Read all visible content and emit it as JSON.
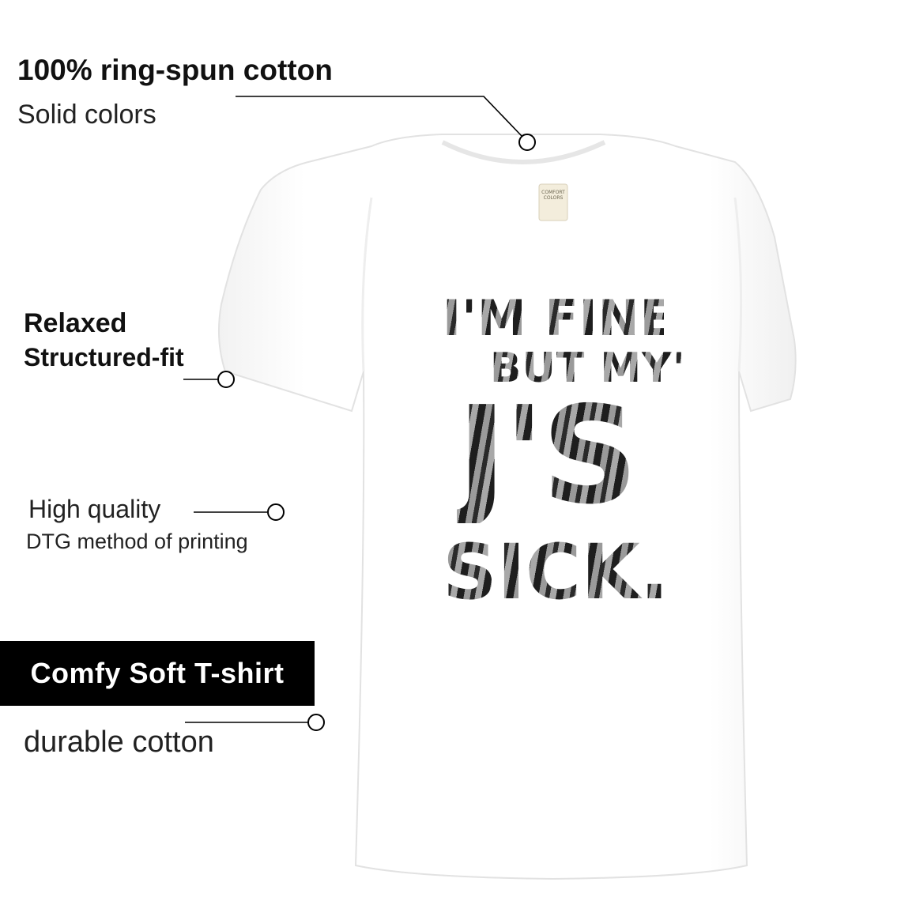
{
  "features": {
    "cotton": {
      "title": "100% ring-spun cotton",
      "subtitle": "Solid colors"
    },
    "fit": {
      "line1": "Relaxed",
      "line2": "Structured-fit"
    },
    "quality": {
      "line1": "High quality",
      "line2": "DTG method of printing"
    },
    "badge": "Comfy Soft T-shirt",
    "durable": "durable cotton"
  },
  "shirt": {
    "label_lines": [
      "COMFORT",
      "COLORS"
    ],
    "print_lines": [
      "I'M FINE,",
      "BUT MY'",
      "J'S",
      "SICK."
    ],
    "color": "#ffffff"
  },
  "colors": {
    "text": "#111111",
    "badge_bg": "#000000",
    "badge_text": "#ffffff",
    "callout_line": "#000000"
  }
}
